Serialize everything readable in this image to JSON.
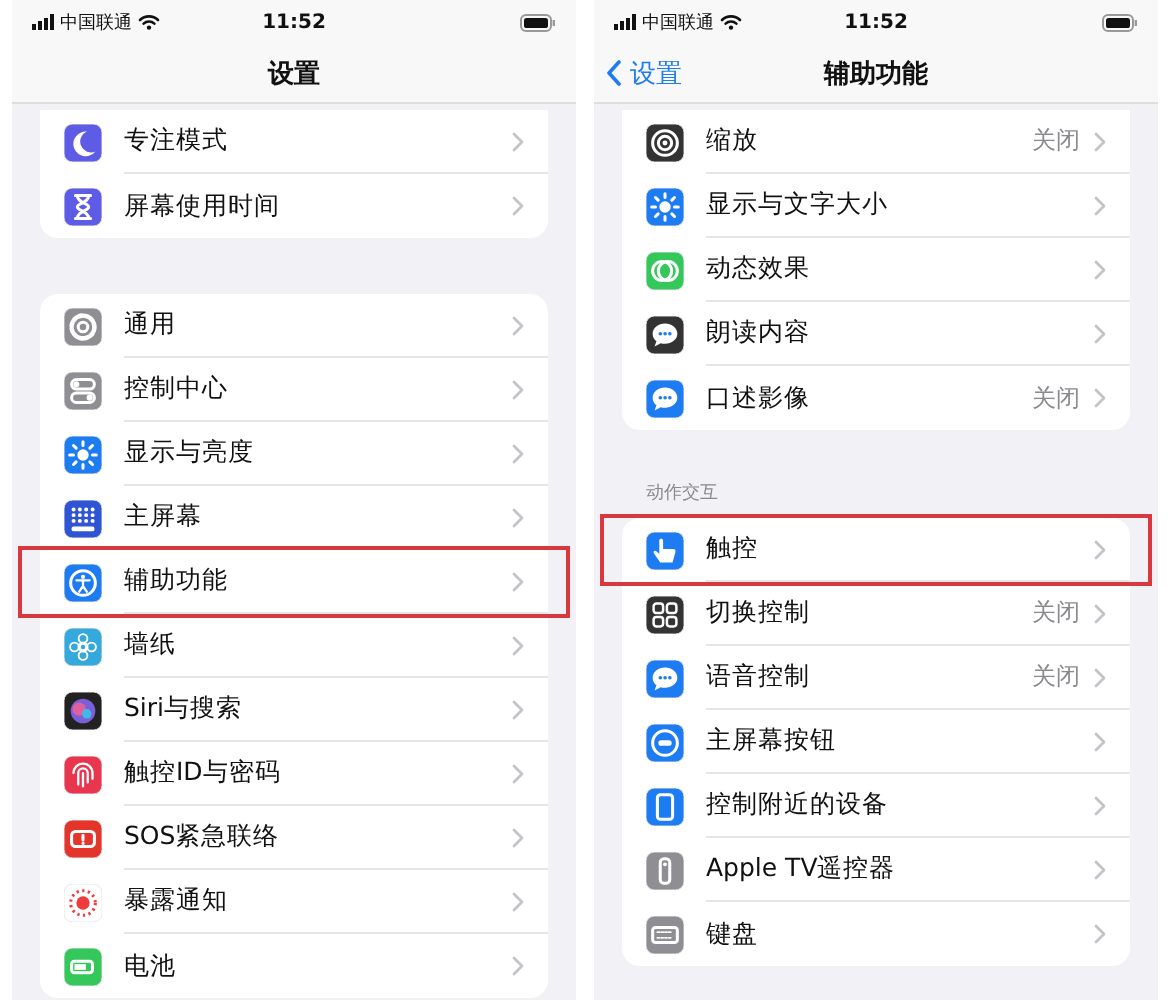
{
  "screens": [
    {
      "status_bar": {
        "carrier": "中国联通",
        "time": "11:52"
      },
      "nav": {
        "title": "设置"
      },
      "groups": [
        {
          "items": [
            {
              "label": "专注模式",
              "color": "#5e5ce6",
              "highlighted": false
            },
            {
              "label": "屏幕使用时间",
              "color": "#5e5ce6",
              "highlighted": false
            }
          ]
        },
        {
          "items": [
            {
              "label": "通用",
              "color": "#8e8e93",
              "highlighted": false
            },
            {
              "label": "控制中心",
              "color": "#8e8e93",
              "highlighted": false
            },
            {
              "label": "显示与亮度",
              "color": "#1e7cf2",
              "highlighted": false
            },
            {
              "label": "主屏幕",
              "color": "#2f55d4",
              "highlighted": false
            },
            {
              "label": "辅助功能",
              "color": "#1e7cf2",
              "highlighted": true
            },
            {
              "label": "墙纸",
              "color": "#35a9dc",
              "highlighted": false
            },
            {
              "label": "Siri与搜索",
              "color": "#222222",
              "highlighted": false
            },
            {
              "label": "触控ID与密码",
              "color": "#e8364f",
              "highlighted": false
            },
            {
              "label": "SOS紧急联络",
              "color": "#e5352b",
              "highlighted": false
            },
            {
              "label": "暴露通知",
              "color": "#ffffff",
              "highlighted": false
            },
            {
              "label": "电池",
              "color": "#34c759",
              "highlighted": false
            }
          ]
        }
      ]
    },
    {
      "status_bar": {
        "carrier": "中国联通",
        "time": "11:52"
      },
      "nav": {
        "back": "设置",
        "title": "辅助功能"
      },
      "groups": [
        {
          "items": [
            {
              "label": "缩放",
              "value": "关闭",
              "color": "#333333",
              "highlighted": false
            },
            {
              "label": "显示与文字大小",
              "color": "#1e7cf2",
              "highlighted": false
            },
            {
              "label": "动态效果",
              "color": "#34c759",
              "highlighted": false
            },
            {
              "label": "朗读内容",
              "color": "#333333",
              "highlighted": false
            },
            {
              "label": "口述影像",
              "value": "关闭",
              "color": "#1e7cf2",
              "highlighted": false
            }
          ]
        },
        {
          "header": "动作交互",
          "items": [
            {
              "label": "触控",
              "color": "#1e7cf2",
              "highlighted": true
            },
            {
              "label": "切换控制",
              "value": "关闭",
              "color": "#333333",
              "highlighted": false
            },
            {
              "label": "语音控制",
              "value": "关闭",
              "color": "#1e7cf2",
              "highlighted": false
            },
            {
              "label": "主屏幕按钮",
              "color": "#1e7cf2",
              "highlighted": false
            },
            {
              "label": "控制附近的设备",
              "color": "#1e7cf2",
              "highlighted": false
            },
            {
              "label": "Apple TV遥控器",
              "color": "#8e8e93",
              "highlighted": false
            },
            {
              "label": "键盘",
              "color": "#8e8e93",
              "highlighted": false
            }
          ]
        }
      ]
    }
  ]
}
